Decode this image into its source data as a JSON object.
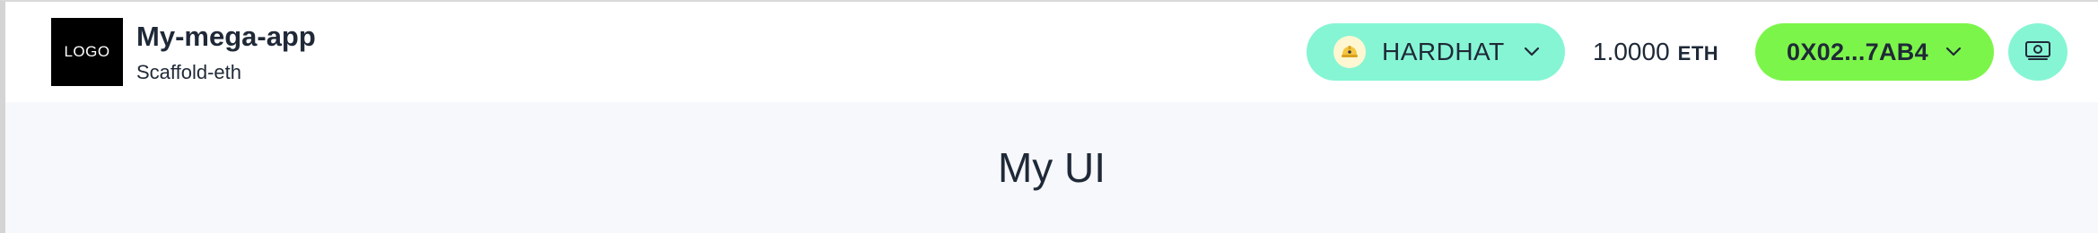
{
  "header": {
    "logo_text": "LOGO",
    "app_title": "My-mega-app",
    "app_subtitle": "Scaffold-eth",
    "network": {
      "label": "HARDHAT",
      "icon": "hardhat-icon",
      "chevron_icon": "chevron-down-icon",
      "color": "#86f5d4"
    },
    "balance": {
      "value": "1.0000",
      "unit": "ETH"
    },
    "account": {
      "address": "0X02...7AB4",
      "chevron_icon": "chevron-down-icon",
      "color": "#7cf54a"
    },
    "faucet": {
      "icon": "banknote-icon",
      "color": "#86f5d4"
    }
  },
  "main": {
    "title": "My UI"
  }
}
